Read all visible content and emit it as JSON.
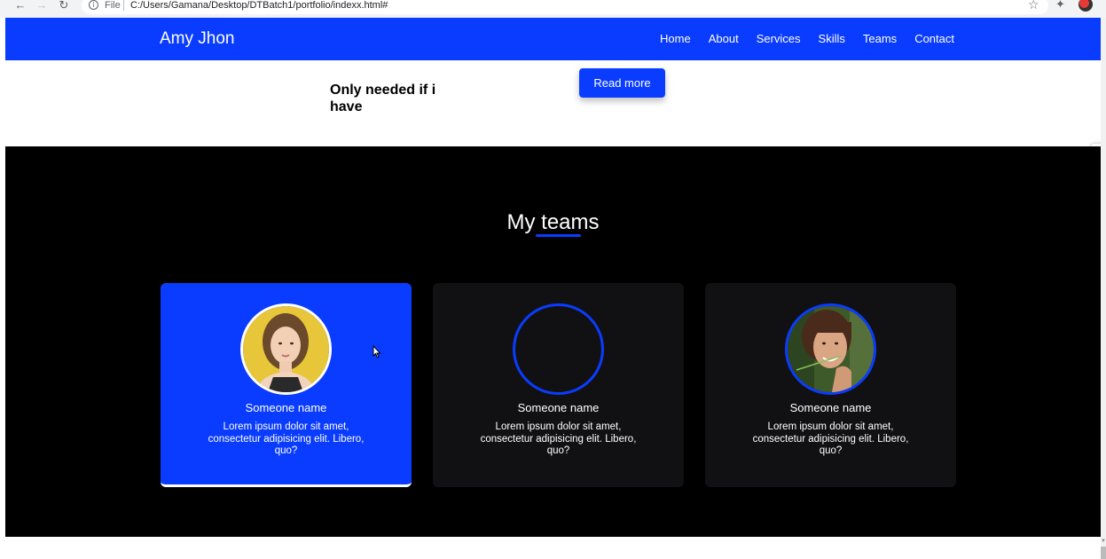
{
  "browser": {
    "scheme_label": "File",
    "url": "C:/Users/Gamana/Desktop/DTBatch1/portfolio/indexx.html#"
  },
  "navbar": {
    "brand": "Amy Jhon",
    "menu": [
      "Home",
      "About",
      "Services",
      "Skills",
      "Teams",
      "Contact"
    ],
    "color": "#0a3cff"
  },
  "intro": {
    "text": "Only needed if i have",
    "read_more_label": "Read more"
  },
  "teams": {
    "title": "My teams",
    "cards": [
      {
        "name": "Someone name",
        "desc": "Lorem ipsum dolor sit amet, consectetur adipisicing elit. Libero, quo?",
        "active": true,
        "avatar": "woman-yellow-background"
      },
      {
        "name": "Someone name",
        "desc": "Lorem ipsum dolor sit amet, consectetur adipisicing elit. Libero, quo?",
        "active": false,
        "avatar": "empty"
      },
      {
        "name": "Someone name",
        "desc": "Lorem ipsum dolor sit amet, consectetur adipisicing elit. Libero, quo?",
        "active": false,
        "avatar": "woman-green-background"
      }
    ]
  },
  "icons": {
    "back": "back-arrow-icon",
    "forward": "forward-arrow-icon",
    "reload": "reload-icon",
    "info": "info-icon",
    "bookmark": "star-icon",
    "extensions": "puzzle-icon",
    "settings": "gear-icon"
  }
}
